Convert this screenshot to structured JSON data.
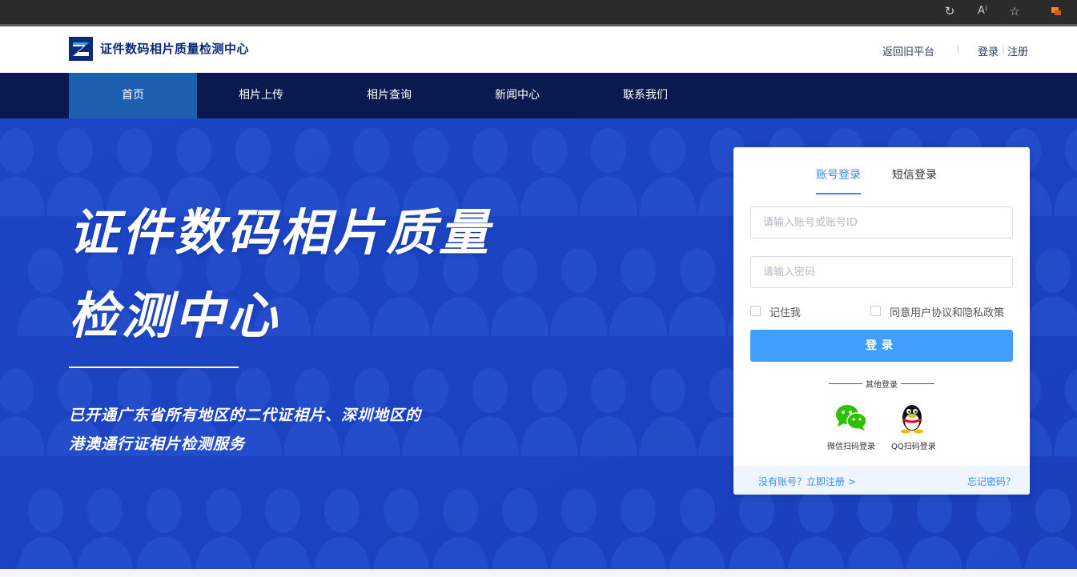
{
  "browser": {
    "icons": [
      "refresh-sync-icon",
      "read-aloud-icon",
      "favorite-star-icon",
      "extension-icon"
    ],
    "read_aloud_glyph": "A⁾"
  },
  "header": {
    "site_name": "证件数码相片质量检测中心",
    "back_link": "返回旧平台",
    "login_link": "登录",
    "divider": "|",
    "register_link": "注册"
  },
  "nav": {
    "items": [
      {
        "label": "首页",
        "active": true
      },
      {
        "label": "相片上传",
        "active": false
      },
      {
        "label": "相片查询",
        "active": false
      },
      {
        "label": "新闻中心",
        "active": false
      },
      {
        "label": "联系我们",
        "active": false
      }
    ]
  },
  "hero": {
    "title_line1": "证件数码相片质量",
    "title_line2": "检测中心",
    "desc_line1": "已开通广东省所有地区的二代证相片、深圳地区的",
    "desc_line2": "港澳通行证相片检测服务"
  },
  "login": {
    "tab_account": "账号登录",
    "tab_sms": "短信登录",
    "account_placeholder": "请输入账号或账号ID",
    "password_placeholder": "请输入密码",
    "remember_me": "记住我",
    "agree_terms": "同意用户协议和隐私政策",
    "submit_label": "登录",
    "other_login": "其他登录",
    "wechat_label": "微信扫码登录",
    "qq_label": "QQ扫码登录",
    "no_account": "没有账号？立即注册 >",
    "forgot_password": "忘记密码？"
  },
  "colors": {
    "brand_navy": "#0b1a4e",
    "nav_active": "#1f5fb0",
    "hero_blue": "#1a44c4",
    "accent_blue": "#409eff",
    "link_blue": "#3b8bf0"
  }
}
